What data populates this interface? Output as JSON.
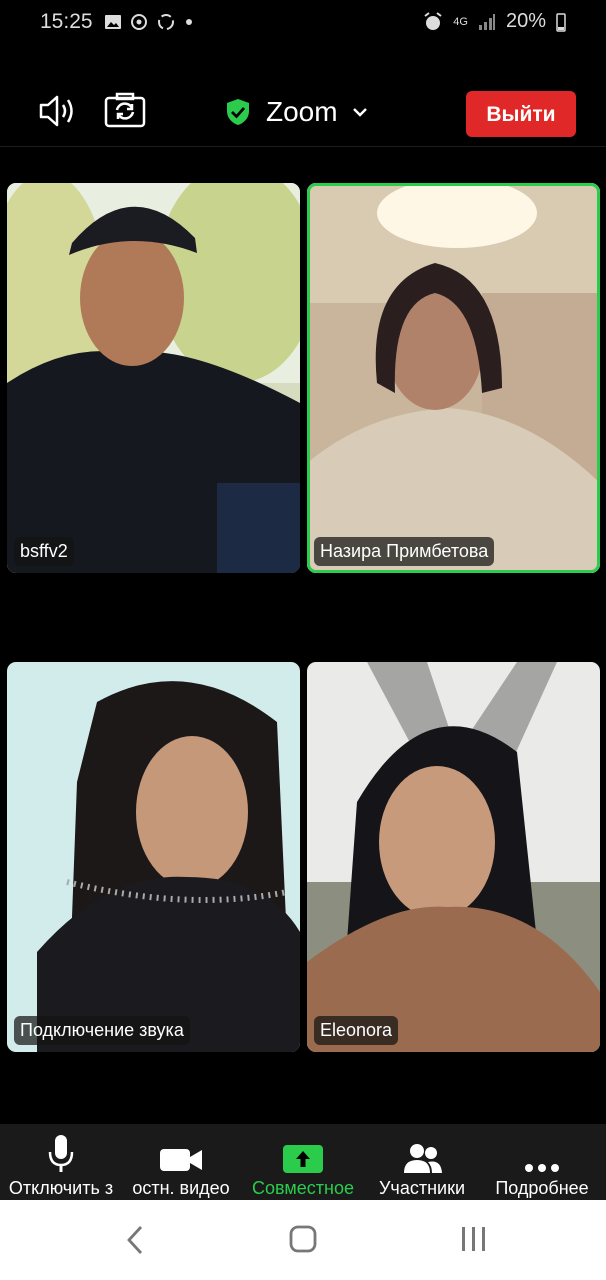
{
  "status_bar": {
    "time": "15:25",
    "network": "4G",
    "battery": "20%"
  },
  "header": {
    "title": "Zoom",
    "leave_label": "Выйти",
    "colors": {
      "leave": "#e02828",
      "shield": "#2bcc4c"
    }
  },
  "participants": [
    {
      "name": "bsffv2",
      "active": false
    },
    {
      "name": "Назира Примбетова",
      "active": true
    },
    {
      "name": "Подключение звука",
      "active": false
    },
    {
      "name": "Eleonora",
      "active": false
    }
  ],
  "toolbar": {
    "mute_label": "Отключить з",
    "video_label": "остн. видео",
    "share_label": "Совместное",
    "participants_label": "Участники",
    "more_label": "Подробнее"
  },
  "colors": {
    "accent_green": "#2bcc4c",
    "toolbar_bg": "#1a1a1a"
  }
}
